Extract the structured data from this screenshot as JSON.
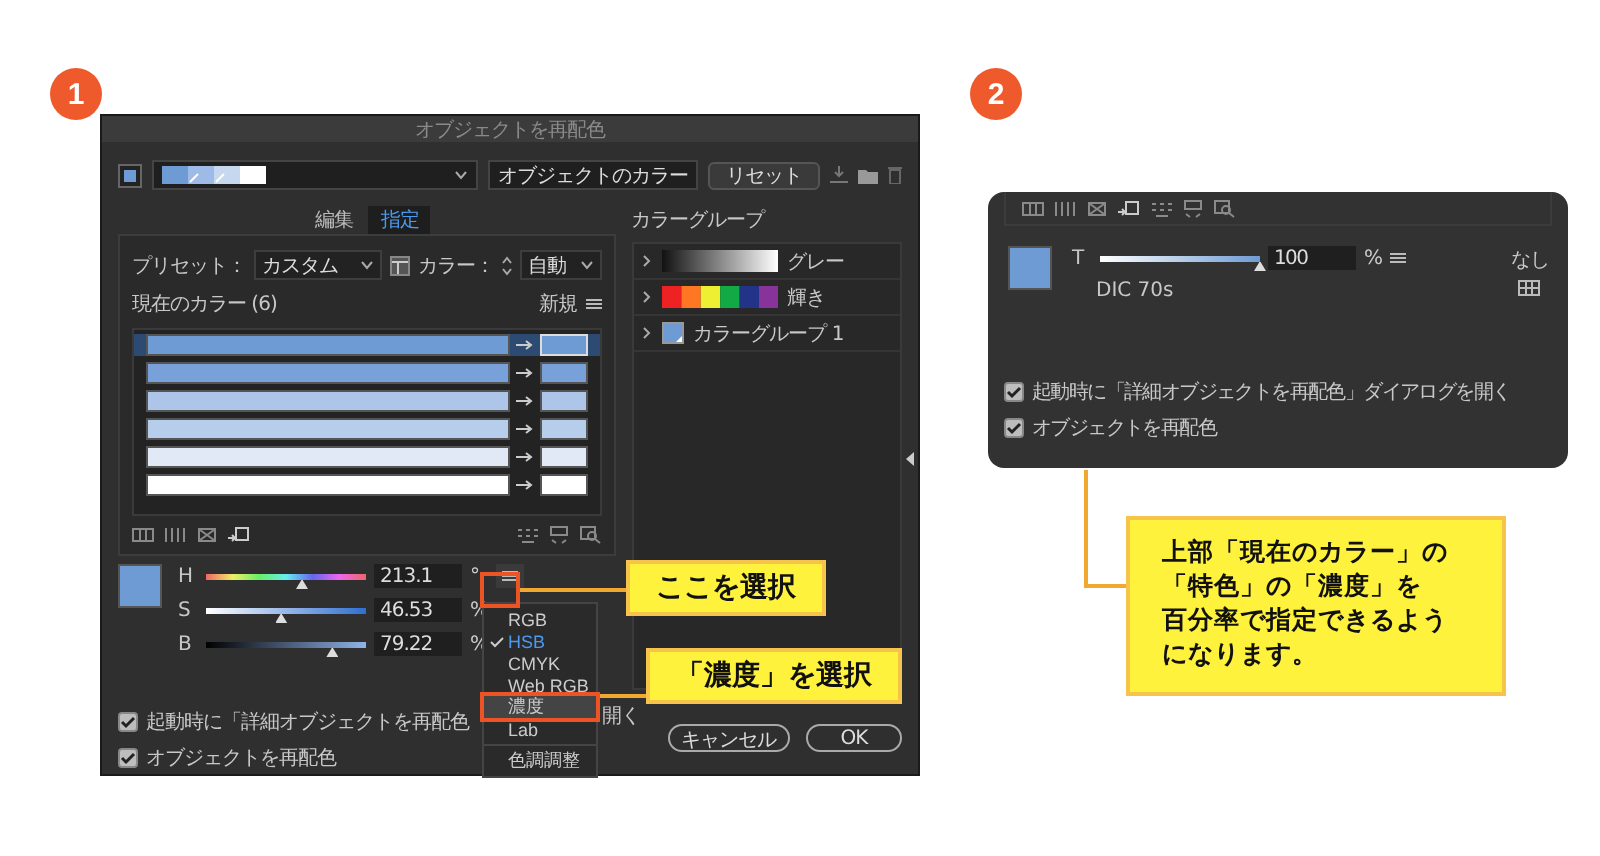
{
  "badges": [
    {
      "label": "1"
    },
    {
      "label": "2"
    }
  ],
  "recolor_dialog": {
    "title": "オブジェクトを再配色",
    "name_field": "オブジェクトのカラー",
    "reset_button": "リセット",
    "tabs": [
      {
        "label": "編集",
        "selected": false
      },
      {
        "label": "指定",
        "selected": true
      }
    ],
    "preset_label": "プリセット：",
    "preset_value": "カスタム",
    "colors_label": "カラー：",
    "colors_value": "自動",
    "current_colors_header": "現在のカラー (6)",
    "new_header": "新規",
    "color_rows": [
      {
        "color": "#6f9bd4",
        "selected": true
      },
      {
        "color": "#77a1d8",
        "selected": false
      },
      {
        "color": "#adc5e9",
        "selected": false
      },
      {
        "color": "#b7cdec",
        "selected": false
      },
      {
        "color": "#e1e9f6",
        "selected": false
      },
      {
        "color": "#ffffff",
        "selected": false
      }
    ],
    "color_groups_header": "カラーグループ",
    "color_groups": [
      {
        "name": "グレー",
        "kind": "grays"
      },
      {
        "name": "輝き",
        "kind": "rainbow"
      },
      {
        "name": "カラーグループ 1",
        "kind": "folder"
      }
    ],
    "sliders": [
      {
        "label": "H",
        "kind": "hue",
        "level": 0.6,
        "value": "213.1",
        "unit": "°"
      },
      {
        "label": "S",
        "kind": "saturation",
        "level": 0.47,
        "value": "46.53",
        "unit": "%"
      },
      {
        "label": "B",
        "kind": "brightness",
        "level": 0.79,
        "value": "79.22",
        "unit": "%"
      }
    ],
    "mode_menu": {
      "items": [
        {
          "label": "RGB",
          "checked": false,
          "selected": false
        },
        {
          "label": "HSB",
          "checked": true,
          "selected": false
        },
        {
          "label": "CMYK",
          "checked": false,
          "selected": false
        },
        {
          "label": "Web RGB",
          "checked": false,
          "selected": false
        },
        {
          "label": "濃度",
          "checked": false,
          "selected": true
        },
        {
          "label": "Lab",
          "checked": false,
          "selected": false
        }
      ],
      "footer_item": "色調調整"
    },
    "checkboxes": [
      {
        "label": "起動時に「詳細オブジェクトを再配色",
        "tail": "開く",
        "checked": true
      },
      {
        "label": "オブジェクトを再配色",
        "checked": true
      }
    ],
    "cancel_button": "キャンセル",
    "ok_button": "OK"
  },
  "callouts": [
    {
      "kind": "label",
      "text": "ここを選択"
    },
    {
      "kind": "label",
      "text": "「濃度」を選択"
    },
    {
      "kind": "note",
      "lines": [
        "上部「現在のカラー」の",
        "「特色」の「濃度」を",
        "百分率で指定できるよう",
        "になります。"
      ]
    }
  ],
  "spot_panel": {
    "none_label": "なし",
    "tint": {
      "label": "T",
      "level": 1,
      "value": "100",
      "unit": "%"
    },
    "color_name": "DIC 70s",
    "checkboxes": [
      {
        "label": "起動時に「詳細オブジェクトを再配色」ダイアログを開く",
        "checked": true
      },
      {
        "label": "オブジェクトを再配色",
        "checked": true
      }
    ]
  }
}
